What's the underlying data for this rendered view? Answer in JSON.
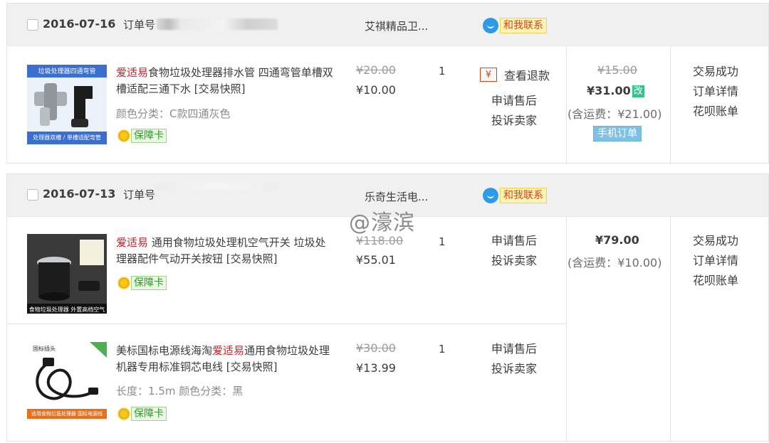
{
  "orders": [
    {
      "date": "2016-07-16",
      "order_no_label": "订单号",
      "shop": "艾祺精品卫...",
      "contact": "和我联系",
      "items": [
        {
          "thumb_label_top": "垃圾处理器四通弯管",
          "thumb_label_bottom": "处理器双槽 / 单槽适配弯管",
          "brand": "爱适易",
          "title": "食物垃圾处理器排水管 四通弯管单槽双槽适配三通下水 [交易快照]",
          "sku": "颜色分类：C款四通灰色",
          "guard": "保障卡",
          "price_old": "¥20.00",
          "price_now": "¥10.00",
          "qty": "1",
          "refund": "查看退款",
          "links": [
            "申请售后",
            "投诉卖家"
          ]
        }
      ],
      "total_old": "¥15.00",
      "total": "¥31.00",
      "modified_badge": "改",
      "shipping": "(含运费：¥21.00)",
      "mobile_badge": "手机订单",
      "status_links": [
        "交易成功",
        "订单详情",
        "花呗账单"
      ]
    },
    {
      "date": "2016-07-13",
      "order_no_label": "订单号",
      "shop": "乐奇生活电...",
      "contact": "和我联系",
      "items": [
        {
          "thumb_label_bottom": "食物垃圾处理器 外置高档空气开关",
          "brand": "爱适易",
          "title": " 通用食物垃圾处理机空气开关 垃圾处理器配件气动开关按钮 [交易快照]",
          "guard": "保障卡",
          "price_old": "¥118.00",
          "price_now": "¥55.01",
          "qty": "1",
          "links": [
            "申请售后",
            "投诉卖家"
          ]
        },
        {
          "thumb_label_top": "国标插头",
          "thumb_label_bottom": "适用食物垃圾处理器 国标电源线",
          "title_pre": "美标国标电源线海淘",
          "brand": "爱适易",
          "title": "通用食物垃圾处理机器专用标准铜芯电线 [交易快照]",
          "sku": "长度：1.5m  颜色分类：黑",
          "guard": "保障卡",
          "price_old": "¥30.00",
          "price_now": "¥13.99",
          "qty": "1",
          "links": [
            "申请售后",
            "投诉卖家"
          ]
        }
      ],
      "total": "¥79.00",
      "shipping": "(含运费：¥10.00)",
      "status_links": [
        "交易成功",
        "订单详情",
        "花呗账单"
      ]
    }
  ],
  "watermark": "@濠滨"
}
